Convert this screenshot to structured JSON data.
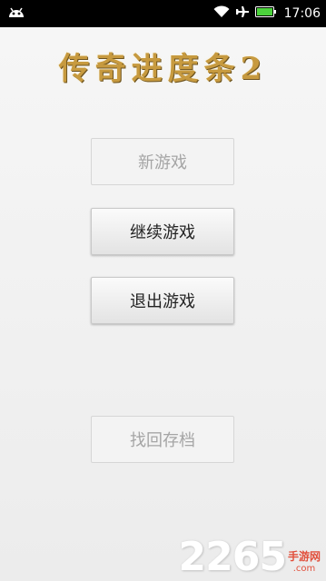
{
  "statusbar": {
    "time": "17:06",
    "icons": [
      "android-icon",
      "wifi-icon",
      "battery-icon",
      "airplane-mode-icon"
    ]
  },
  "app": {
    "title": "传奇进度条2",
    "title_color": "#c79a3f"
  },
  "buttons": [
    {
      "label": "新游戏",
      "enabled": false
    },
    {
      "label": "继续游戏",
      "enabled": true
    },
    {
      "label": "退出游戏",
      "enabled": true
    },
    {
      "label": "找回存档",
      "enabled": false
    }
  ],
  "watermark": {
    "number": "2265",
    "site_cn": "手游网",
    "domain": ".com"
  }
}
